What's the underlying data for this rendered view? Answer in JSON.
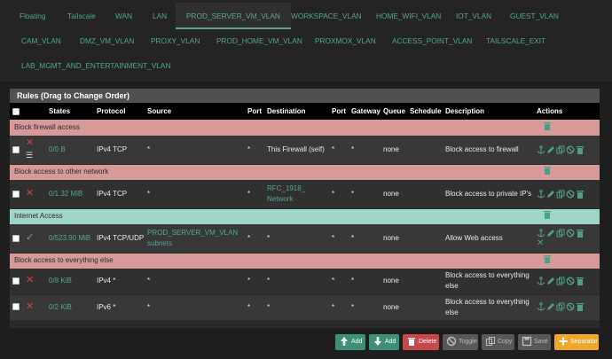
{
  "tabs": [
    {
      "label": "Floating"
    },
    {
      "label": "Tailscale"
    },
    {
      "label": "WAN"
    },
    {
      "label": "LAN"
    },
    {
      "label": "PROD_SERVER_VM_VLAN"
    },
    {
      "label": "WORKSPACE_VLAN"
    },
    {
      "label": "HOME_WIFI_VLAN"
    },
    {
      "label": "IOT_VLAN"
    },
    {
      "label": "GUEST_VLAN"
    },
    {
      "label": "CAM_VLAN"
    },
    {
      "label": "DMZ_VM_VLAN"
    },
    {
      "label": "PROXY_VLAN"
    },
    {
      "label": "PROD_HOME_VM_VLAN"
    },
    {
      "label": "PROXMOX_VLAN"
    },
    {
      "label": "ACCESS_POINT_VLAN"
    },
    {
      "label": "TAILSCALE_EXIT"
    },
    {
      "label": "LAB_MGMT_AND_ENTERTAINMENT_VLAN"
    }
  ],
  "active_tab": "PROD_SERVER_VM_VLAN",
  "panel": {
    "title": "Rules (Drag to Change Order)",
    "columns": [
      "States",
      "Protocol",
      "Source",
      "Port",
      "Destination",
      "Port",
      "Gateway",
      "Queue",
      "Schedule",
      "Description",
      "Actions"
    ]
  },
  "groups": [
    {
      "separator": "Block firewall access",
      "color": "red",
      "rules": [
        {
          "status": "block",
          "has_list_icon": true,
          "states": "0/0 B",
          "protocol": "IPv4 TCP",
          "source": "*",
          "port": "*",
          "destination": "This Firewall (self)",
          "dest_port": "*",
          "gateway": "*",
          "queue": "none",
          "schedule": "",
          "description": "Block access to firewall"
        }
      ]
    },
    {
      "separator": "Block access to other network",
      "color": "red",
      "rules": [
        {
          "status": "block",
          "has_list_icon": false,
          "states": "0/1.32 MiB",
          "protocol": "IPv4 TCP",
          "source": "*",
          "port": "*",
          "destination": "RFC_1918_ Network",
          "dest_port": "*",
          "gateway": "*",
          "queue": "none",
          "schedule": "",
          "description": "Block access to private IP's"
        }
      ]
    },
    {
      "separator": "Internet Access",
      "color": "teal",
      "rules": [
        {
          "status": "pass",
          "has_list_icon": false,
          "states": "0/523.90 MiB",
          "protocol": "IPv4 TCP/UDP",
          "source": "PROD_SERVER_VM_VLAN subnets",
          "port": "*",
          "destination": "*",
          "dest_port": "*",
          "gateway": "*",
          "queue": "none",
          "schedule": "",
          "description": "Allow Web access"
        }
      ]
    },
    {
      "separator": "Block access to everything else",
      "color": "red",
      "rules": [
        {
          "status": "block",
          "has_list_icon": false,
          "states": "0/8 KiB",
          "protocol": "IPv4 *",
          "source": "*",
          "port": "*",
          "destination": "*",
          "dest_port": "*",
          "gateway": "*",
          "queue": "none",
          "schedule": "",
          "description": "Block access to everything else"
        },
        {
          "status": "block",
          "has_list_icon": false,
          "states": "0/2 KiB",
          "protocol": "IPv6 *",
          "source": "*",
          "port": "*",
          "destination": "*",
          "dest_port": "*",
          "gateway": "*",
          "queue": "none",
          "schedule": "",
          "description": "Block access to everything else"
        }
      ]
    }
  ],
  "buttons": {
    "add_top": "Add",
    "add_bottom": "Add",
    "delete": "Delete",
    "toggle": "Toggle",
    "copy": "Copy",
    "save": "Save",
    "separator": "Separator"
  },
  "colors": {
    "accent": "#5ca68f",
    "separator_red": "#d69a9b",
    "separator_teal": "#9fd4cb",
    "block": "#d23f3f",
    "pass": "#5bbd4f"
  }
}
